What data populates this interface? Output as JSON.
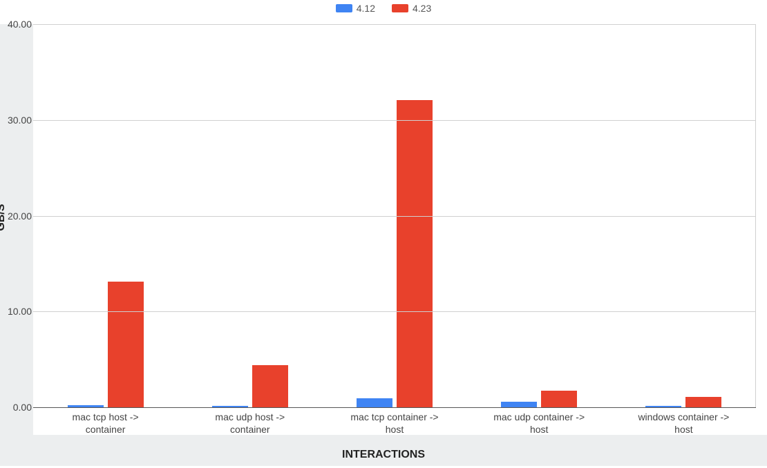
{
  "chart_data": {
    "type": "bar",
    "categories": [
      "mac tcp host -> container",
      "mac udp host -> container",
      "mac tcp container -> host",
      "mac udp container -> host",
      "windows container -> host"
    ],
    "series": [
      {
        "name": "4.12",
        "color": "#3f84f3",
        "values": [
          0.21,
          0.12,
          0.95,
          0.58,
          0.15
        ]
      },
      {
        "name": "4.23",
        "color": "#e8412c",
        "values": [
          13.1,
          4.4,
          32.1,
          1.75,
          1.05
        ]
      }
    ],
    "y_ticks": [
      0.0,
      10.0,
      20.0,
      30.0,
      40.0
    ],
    "ylim": [
      0,
      40
    ],
    "xlabel": "INTERACTIONS",
    "ylabel": "GB/S",
    "title": ""
  }
}
